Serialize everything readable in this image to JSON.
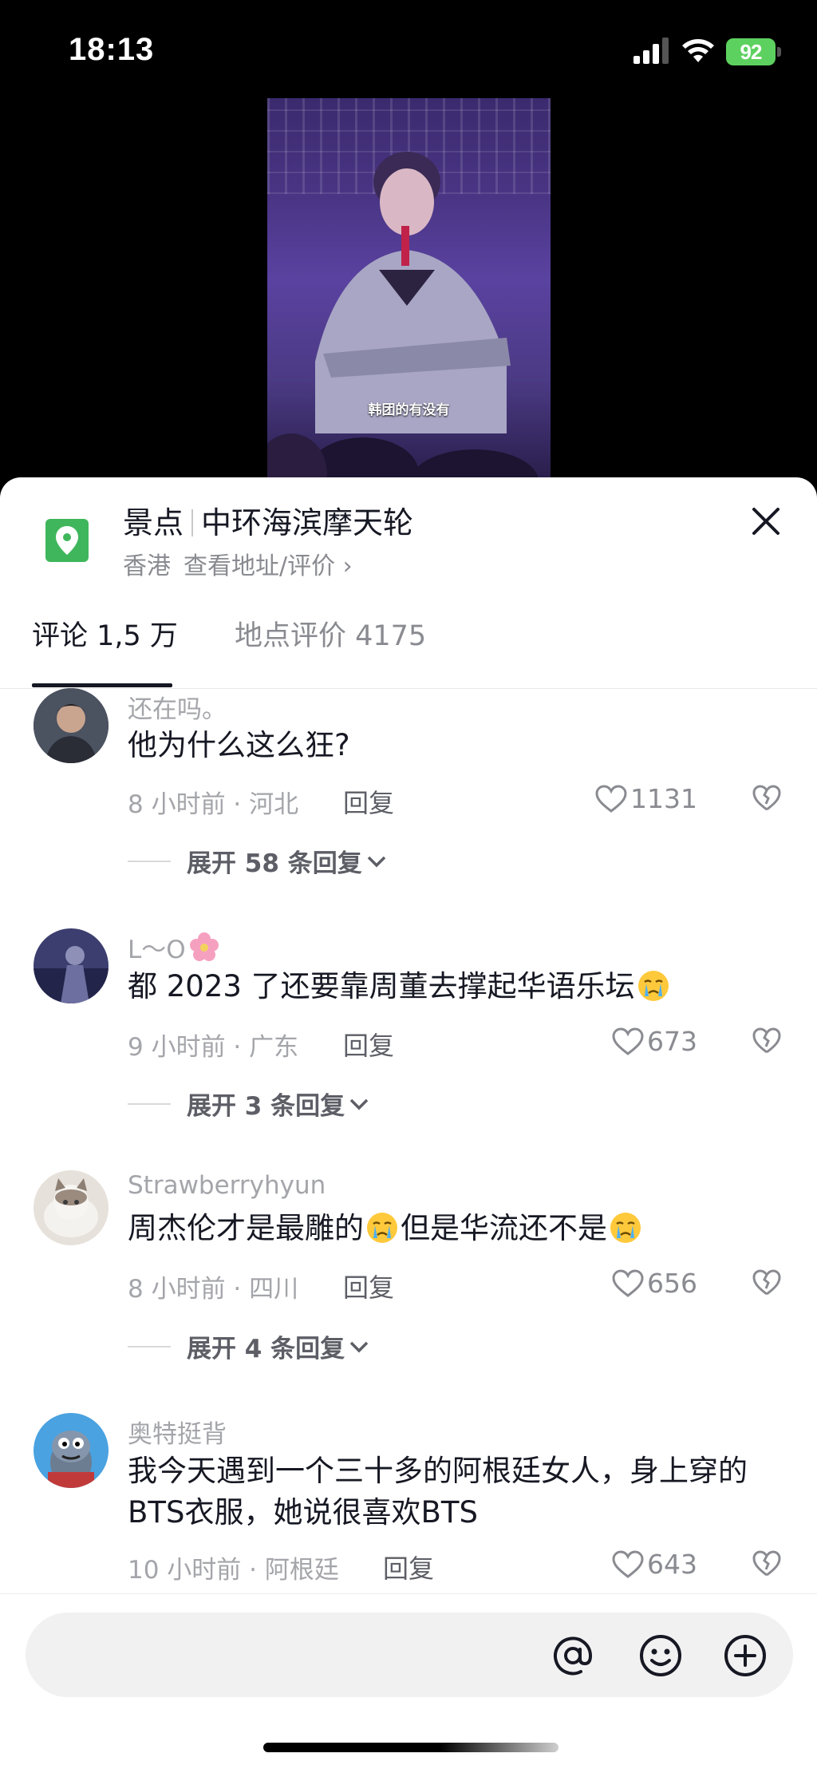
{
  "status_bar": {
    "time": "18:13",
    "battery": "92"
  },
  "video": {
    "caption": "韩团的有没有"
  },
  "location": {
    "category": "景点",
    "name": "中环海滨摩天轮",
    "region": "香港",
    "link": "查看地址/评价 ›"
  },
  "tabs": [
    {
      "label": "评论 1,5 万"
    },
    {
      "label": "地点评价 4175"
    }
  ],
  "comments": [
    {
      "user": "还在吗。",
      "text": "他为什么这么狂?",
      "meta": "8 小时前 · 河北",
      "reply": "回复",
      "likes": "1131",
      "expand": "展开 58 条回复"
    },
    {
      "user": "L～O",
      "text_before": "都 2023 了还要靠周董去撑起华语乐坛",
      "meta": "9 小时前 · 广东",
      "reply": "回复",
      "likes": "673",
      "expand": "展开 3 条回复"
    },
    {
      "user": "Strawberryhyun",
      "text_a": "周杰伦才是最雕的",
      "text_b": "但是华流还不是",
      "meta": "8 小时前 · 四川",
      "reply": "回复",
      "likes": "656",
      "expand": "展开 4 条回复"
    },
    {
      "user": "奥特挺背",
      "text": "我今天遇到一个三十多的阿根廷女人，身上穿的BTS衣服，她说很喜欢BTS",
      "meta": "10 小时前 · 阿根廷",
      "reply": "回复",
      "likes": "643"
    }
  ],
  "input": {
    "placeholder": ""
  },
  "icons": {
    "location": "map-pin-icon",
    "close": "close-icon",
    "like": "heart-icon",
    "dislike": "broken-heart-icon",
    "mention": "at-icon",
    "emoji": "smiley-icon",
    "add": "plus-circle-icon"
  },
  "colors": {
    "accent_green": "#3fb65b",
    "battery_green": "#5dd15f"
  }
}
